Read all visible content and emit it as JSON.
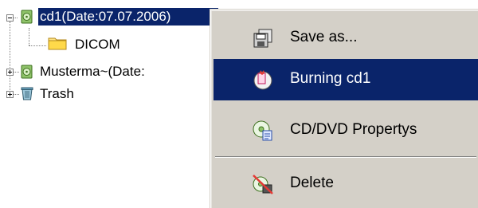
{
  "tree": {
    "items": [
      {
        "label": "cd1(Date:07.07.2006)",
        "icon": "cd-drive-icon",
        "selected": true,
        "expanded": true
      },
      {
        "label": "DICOM",
        "icon": "folder-icon",
        "selected": false
      },
      {
        "label": "Musterma~(Date:",
        "icon": "cd-drive-icon",
        "selected": false,
        "expanded": false
      },
      {
        "label": "Trash",
        "icon": "trash-icon",
        "selected": false,
        "expanded": false
      }
    ]
  },
  "context_menu": {
    "items": [
      {
        "label": "Save as...",
        "icon": "save-as-icon"
      },
      {
        "label": "Burning cd1",
        "icon": "burn-cd-icon",
        "highlighted": true
      },
      {
        "label": "CD/DVD Propertys",
        "icon": "cd-properties-icon"
      },
      {
        "label": "Delete",
        "icon": "delete-icon"
      }
    ]
  },
  "colors": {
    "selection": "#0a246a",
    "menu_background": "#d4d0c8",
    "window_background": "#ffffff"
  }
}
